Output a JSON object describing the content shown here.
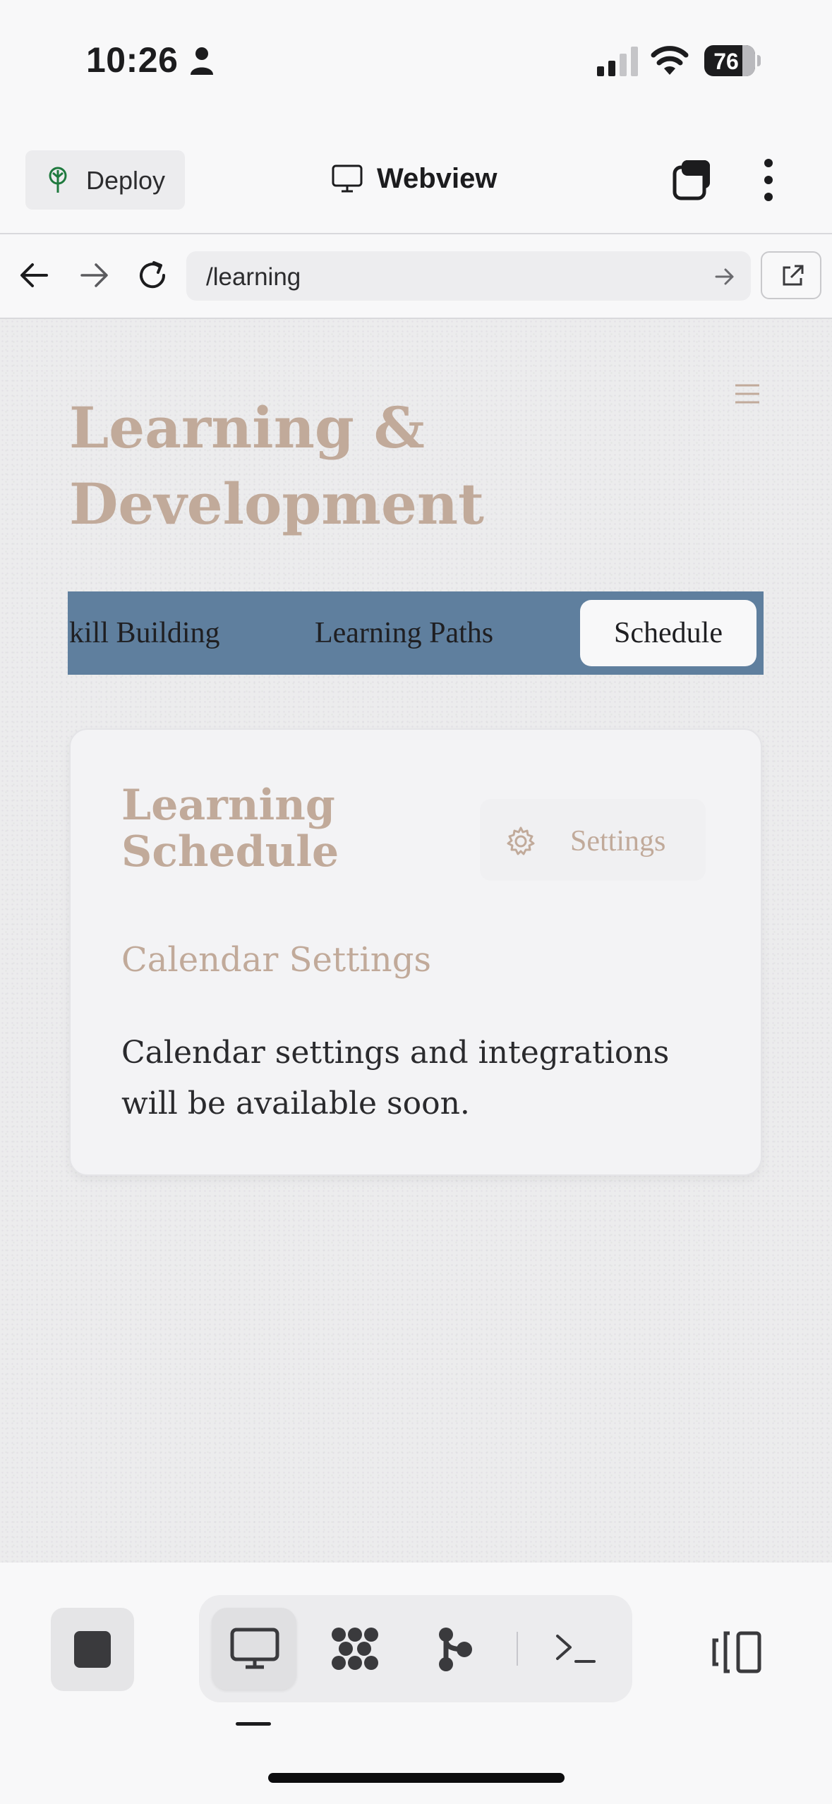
{
  "status_bar": {
    "time": "10:26",
    "battery": "76"
  },
  "header": {
    "deploy_label": "Deploy",
    "title": "Webview"
  },
  "url_bar": {
    "url": "/learning"
  },
  "page": {
    "title": "Learning & Development",
    "tabs": [
      {
        "label": "kill Building"
      },
      {
        "label": "Learning Paths"
      },
      {
        "label": "Schedule"
      }
    ],
    "card": {
      "title": "Learning Schedule",
      "settings_label": "Settings",
      "subheading": "Calendar Settings",
      "body": "Calendar settings and integrations will be available soon."
    }
  },
  "colors": {
    "accent_tan": "#c1aa9a",
    "tab_bar": "#5f7f9e"
  },
  "icons": [
    "person-icon",
    "signal-icon",
    "wifi-icon",
    "battery-icon",
    "deploy-icon",
    "monitor-icon",
    "tabs-icon",
    "more-icon",
    "back-icon",
    "forward-icon",
    "reload-icon",
    "go-icon",
    "open-external-icon",
    "menu-icon",
    "gear-icon",
    "stop-icon",
    "webview-icon",
    "apps-icon",
    "git-icon",
    "terminal-icon",
    "panels-icon"
  ]
}
